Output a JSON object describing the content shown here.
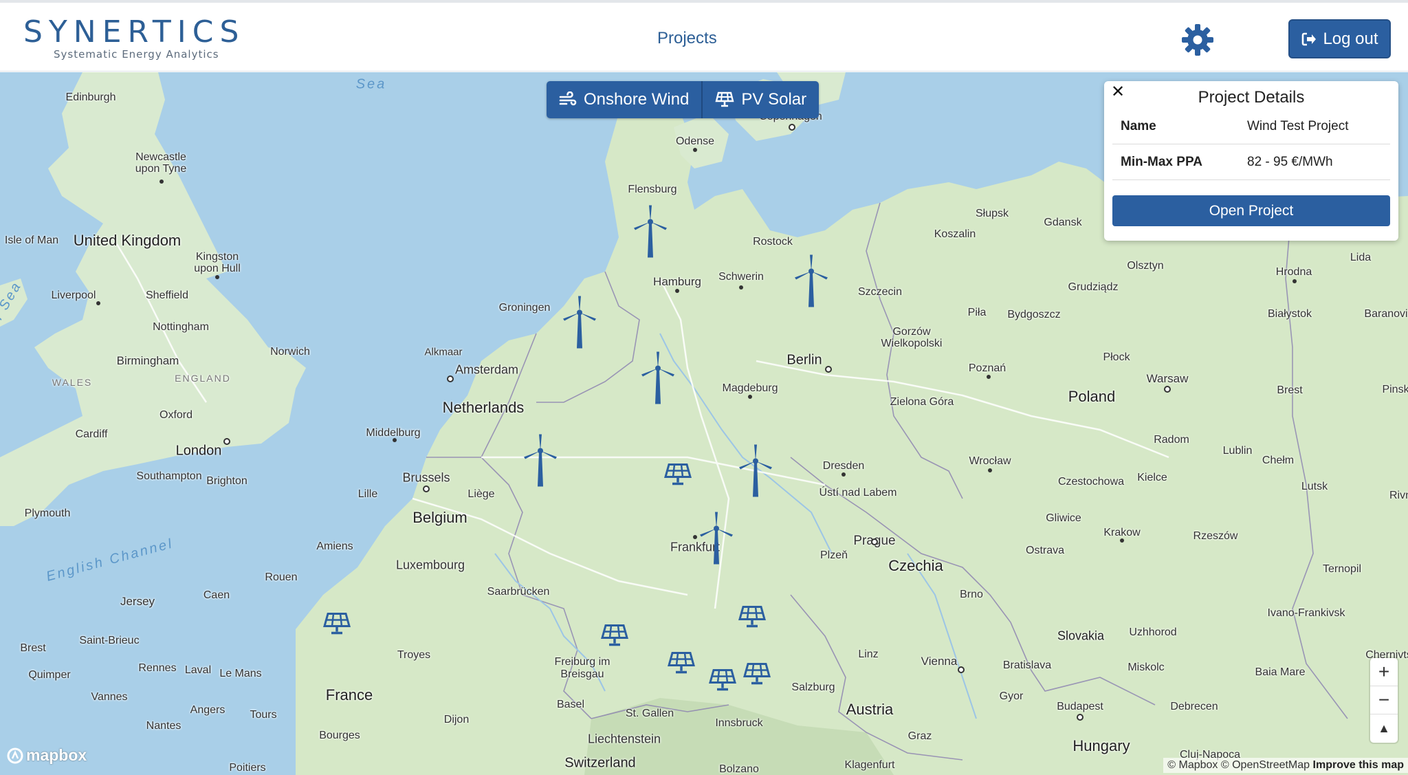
{
  "app": {
    "logo_text": "SYNERTICS",
    "logo_tagline": "Systematic Energy Analytics",
    "nav_projects": "Projects",
    "logout_label": "Log out",
    "settings_icon": "gear-icon"
  },
  "map": {
    "toggle": {
      "wind_label": "Onshore Wind",
      "solar_label": "PV Solar"
    },
    "popup": {
      "title": "Project Details",
      "close_symbol": "✕",
      "name_key": "Name",
      "name_value": "Wind Test Project",
      "ppa_key": "Min-Max PPA",
      "ppa_value": "82 - 95 €/MWh",
      "open_label": "Open Project"
    },
    "zoom_in": "+",
    "zoom_out": "−",
    "compass": "▲",
    "mapbox_logo": "mapbox",
    "attribution": "© Mapbox © OpenStreetMap",
    "improve": "Improve this map",
    "labels": {
      "edinburgh": "Edinburgh",
      "newcastle": "Newcastle upon Tyne",
      "uk": "United Kingdom",
      "isle_of_man": "Isle of Man",
      "kingston": "Kingston upon Hull",
      "liverpool": "Liverpool",
      "sheffield": "Sheffield",
      "nottingham": "Nottingham",
      "norwich": "Norwich",
      "birmingham": "Birmingham",
      "wales": "WALES",
      "england": "ENGLAND",
      "oxford": "Oxford",
      "cardiff": "Cardiff",
      "london": "London",
      "southampton": "Southampton",
      "brighton": "Brighton",
      "plymouth": "Plymouth",
      "english_channel": "English Channel",
      "jersey": "Jersey",
      "amiens": "Amiens",
      "rouen": "Rouen",
      "caen": "Caen",
      "saint_brieuc": "Saint-Brieuc",
      "brest": "Brest",
      "quimper": "Quimper",
      "rennes": "Rennes",
      "laval": "Laval",
      "le_mans": "Le Mans",
      "vannes": "Vannes",
      "angers": "Angers",
      "nantes": "Nantes",
      "tours": "Tours",
      "france": "France",
      "bourges": "Bourges",
      "poitiers": "Poitiers",
      "troyes": "Troyes",
      "dijon": "Dijon",
      "lille": "Lille",
      "brussels": "Brussels",
      "belgium": "Belgium",
      "liege": "Liège",
      "middelburg": "Middelburg",
      "netherlands": "Netherlands",
      "amsterdam": "Amsterdam",
      "alkmaar": "Alkmaar",
      "groningen": "Groningen",
      "luxembourg": "Luxembourg",
      "saarbrucken": "Saarbrücken",
      "frankfurt": "Frankfurt",
      "freiburg": "Freiburg im Breisgau",
      "basel": "Basel",
      "st_gallen": "St. Gallen",
      "liechtenstein": "Liechtenstein",
      "switzerland": "Switzerland",
      "innsbruck": "Innsbruck",
      "bolzano": "Bolzano",
      "salzburg": "Salzburg",
      "austria": "Austria",
      "klagenfurt": "Klagenfurt",
      "graz": "Graz",
      "linz": "Linz",
      "vienna": "Vienna",
      "bratislava": "Bratislava",
      "gyor": "Gyor",
      "budapest": "Budapest",
      "hungary": "Hungary",
      "debrecen": "Debrecen",
      "cluj": "Cluj-Napoca",
      "brno": "Brno",
      "slovakia": "Slovakia",
      "uzhhorod": "Uzhhorod",
      "miskolc": "Miskolc",
      "baia_mare": "Baia Mare",
      "ivano": "Ivano-Frankivsk",
      "chernivtsi": "Chernivts",
      "ternopil": "Ternopil",
      "czechia": "Czechia",
      "prague": "Prague",
      "plzen": "Plzeň",
      "usti": "Ústí nad Labem",
      "dresden": "Dresden",
      "ostrava": "Ostrava",
      "gliwice": "Gliwice",
      "krakow": "Krakow",
      "rzeszow": "Rzeszów",
      "lutsk": "Lutsk",
      "rivne": "Rivn",
      "czestochowa": "Czestochowa",
      "kielce": "Kielce",
      "radom": "Radom",
      "lublin": "Lublin",
      "chelm": "Chełm",
      "brest_by": "Brest",
      "pinsk": "Pinsk",
      "warsaw": "Warsaw",
      "poland": "Poland",
      "wroclaw": "Wrocław",
      "zielona": "Zielona Góra",
      "poznan": "Poznań",
      "plock": "Płock",
      "bialystok": "Białystok",
      "baranovic": "Baranovic",
      "hrodna": "Hrodna",
      "lida": "Lida",
      "olsztyn": "Olsztyn",
      "grudziadz": "Grudziądz",
      "bydgoszcz": "Bydgoszcz",
      "pila": "Piła",
      "gorzow": "Gorzów Wielkopolski",
      "szczecin": "Szczecin",
      "koszalin": "Koszalin",
      "slupsk": "Słupsk",
      "gdansk": "Gdansk",
      "berlin": "Berlin",
      "magdeburg": "Magdeburg",
      "hamburg": "Hamburg",
      "schwerin": "Schwerin",
      "rostock": "Rostock",
      "flensburg": "Flensburg",
      "odense": "Odense",
      "copenhagen": "Copenhagen",
      "sea_top": "Sea",
      "irish_sea": "h Sea"
    }
  }
}
